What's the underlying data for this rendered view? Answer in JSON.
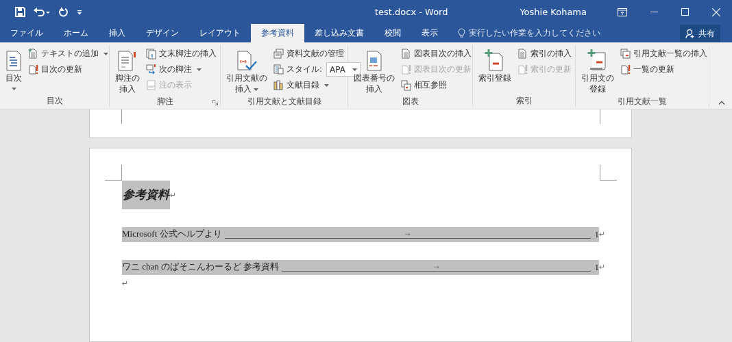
{
  "title_bar": {
    "title": "test.docx - Word",
    "user": "Yoshie Kohama"
  },
  "tabs": [
    {
      "label": "ファイル",
      "selected": false
    },
    {
      "label": "ホーム",
      "selected": false
    },
    {
      "label": "挿入",
      "selected": false
    },
    {
      "label": "デザイン",
      "selected": false
    },
    {
      "label": "レイアウト",
      "selected": false
    },
    {
      "label": "参考資料",
      "selected": true
    },
    {
      "label": "差し込み文書",
      "selected": false
    },
    {
      "label": "校閲",
      "selected": false
    },
    {
      "label": "表示",
      "selected": false
    }
  ],
  "tell_me": {
    "placeholder": "実行したい作業を入力してください"
  },
  "share_button": {
    "label": "共有"
  },
  "ribbon_groups": [
    {
      "label": "目次",
      "has_launcher": false,
      "large": [
        {
          "lines": [
            "目次"
          ],
          "dropdown": true
        }
      ],
      "column": [
        {
          "kind": "button",
          "label": "テキストの追加",
          "dropdown": true,
          "disabled": false
        },
        {
          "kind": "button",
          "label": "目次の更新",
          "dropdown": false,
          "disabled": false
        }
      ]
    },
    {
      "label": "脚注",
      "has_launcher": true,
      "large": [
        {
          "lines": [
            "脚注の",
            "挿入"
          ],
          "dropdown": false
        }
      ],
      "column": [
        {
          "kind": "button",
          "label": "文末脚注の挿入",
          "dropdown": false,
          "disabled": false
        },
        {
          "kind": "button",
          "label": "次の脚注",
          "dropdown": true,
          "disabled": false
        },
        {
          "kind": "button",
          "label": "注の表示",
          "dropdown": false,
          "disabled": true
        }
      ]
    },
    {
      "label": "引用文献と文献目録",
      "has_launcher": false,
      "large": [
        {
          "lines": [
            "引用文献の",
            "挿入"
          ],
          "dropdown": true
        }
      ],
      "column": [
        {
          "kind": "button",
          "label": "資料文献の管理",
          "dropdown": false,
          "disabled": false
        },
        {
          "kind": "select",
          "label": "スタイル:",
          "value": "APA"
        },
        {
          "kind": "button",
          "label": "文献目録",
          "dropdown": true,
          "disabled": false
        }
      ]
    },
    {
      "label": "図表",
      "has_launcher": false,
      "large": [
        {
          "lines": [
            "図表番号の",
            "挿入"
          ],
          "dropdown": false
        }
      ],
      "column": [
        {
          "kind": "button",
          "label": "図表目次の挿入",
          "dropdown": false,
          "disabled": false
        },
        {
          "kind": "button",
          "label": "図表目次の更新",
          "dropdown": false,
          "disabled": true
        },
        {
          "kind": "button",
          "label": "相互参照",
          "dropdown": false,
          "disabled": false
        }
      ]
    },
    {
      "label": "索引",
      "has_launcher": false,
      "large": [
        {
          "lines": [
            "索引登録"
          ],
          "dropdown": false
        }
      ],
      "column": [
        {
          "kind": "button",
          "label": "索引の挿入",
          "dropdown": false,
          "disabled": false
        },
        {
          "kind": "button",
          "label": "索引の更新",
          "dropdown": false,
          "disabled": true
        }
      ]
    },
    {
      "label": "引用文献一覧",
      "has_launcher": false,
      "large": [
        {
          "lines": [
            "引用文の",
            "登録"
          ],
          "dropdown": false
        }
      ],
      "column": [
        {
          "kind": "button",
          "label": "引用文献一覧の挿入",
          "dropdown": false,
          "disabled": false
        },
        {
          "kind": "button",
          "label": "一覧の更新",
          "dropdown": false,
          "disabled": false
        }
      ]
    }
  ],
  "document": {
    "heading": "参考資料",
    "heading_mark": "↵",
    "entries": [
      {
        "text": "Microsoft 公式ヘルプより",
        "tab_mark": "→",
        "page": "1",
        "mark": "↵"
      },
      {
        "text": "ワニ chan のぱそこんわーるど 参考資料",
        "tab_mark": "→",
        "page": "1",
        "mark": "↵"
      }
    ],
    "empty_paragraph_mark": "↵"
  }
}
